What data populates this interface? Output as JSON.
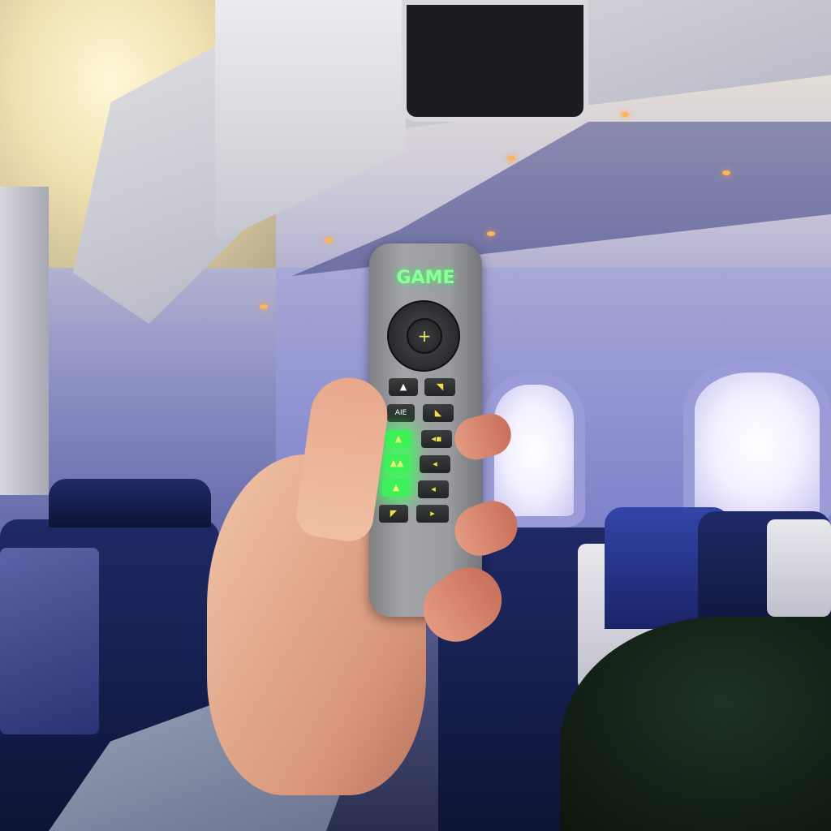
{
  "remote": {
    "label": "GAME",
    "center_button": "+",
    "buttons": [
      {
        "left": "▲",
        "right": "◥"
      },
      {
        "left": "AIE",
        "right": "◣"
      },
      {
        "left": "▲",
        "right": "◂▪"
      },
      {
        "left": "▲▲",
        "right": "◂"
      },
      {
        "left": "▲",
        "right": "◂"
      },
      {
        "left": "◤",
        "right": "▸"
      }
    ]
  },
  "colors": {
    "glow": "#3ef05a",
    "label": "#8dff9a",
    "seat": "#1f2a66"
  }
}
